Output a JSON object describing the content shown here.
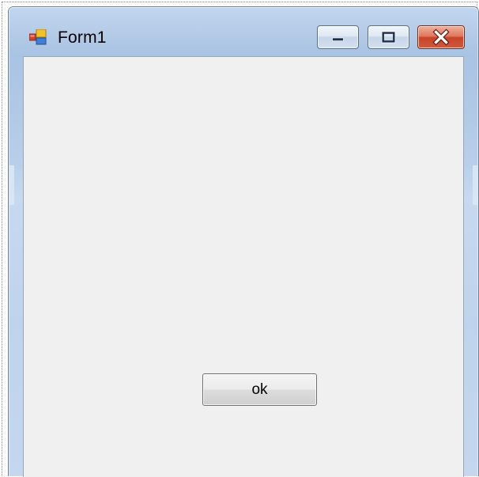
{
  "window": {
    "title": "Form1",
    "icon": "form-app-icon",
    "controls": {
      "minimize_icon": "minimize-icon",
      "maximize_icon": "maximize-icon",
      "close_icon": "close-icon"
    }
  },
  "form": {
    "ok_button_label": "ok"
  },
  "colors": {
    "titlebar": "#b6cce8",
    "client_background": "#f0f0f0",
    "close_button": "#c6442a"
  }
}
